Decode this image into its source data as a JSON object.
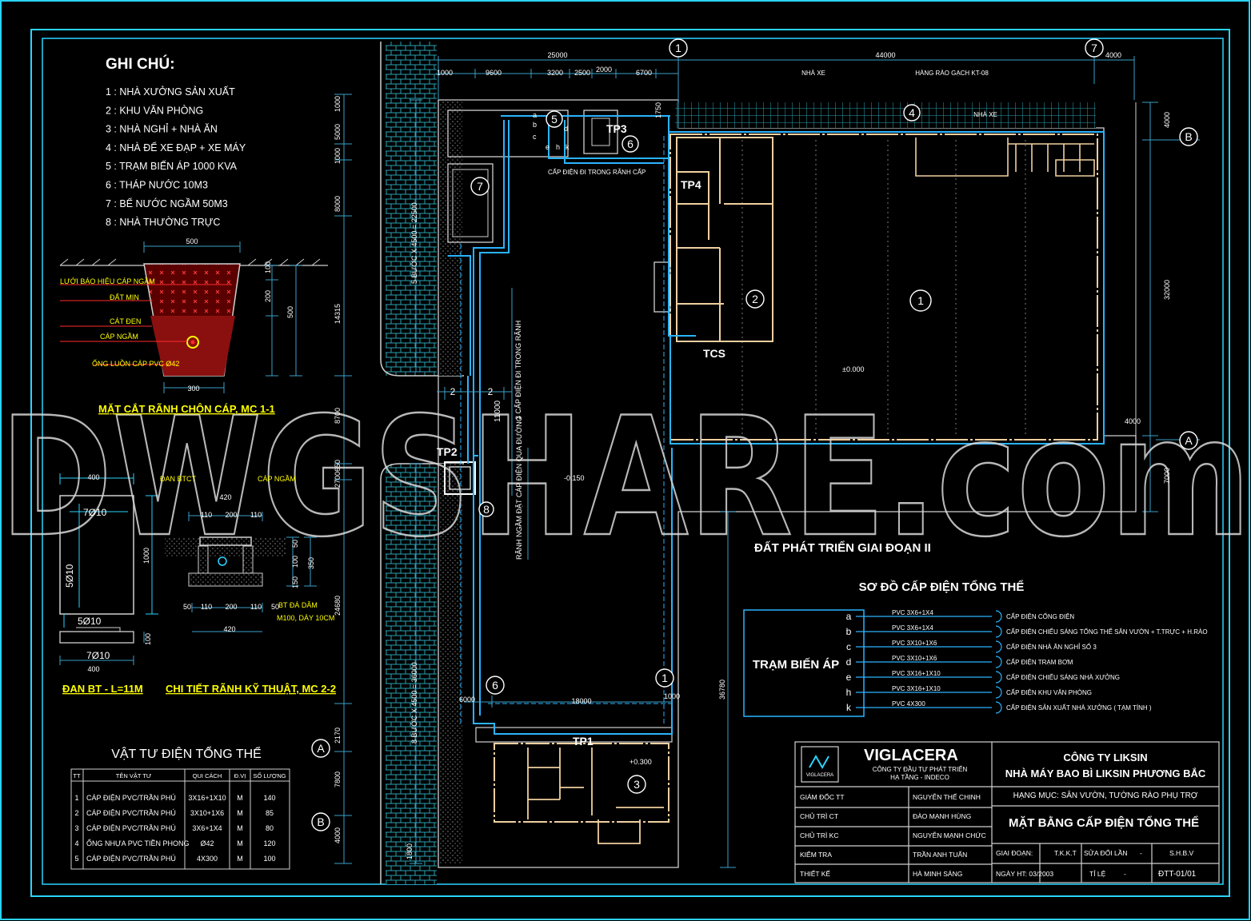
{
  "colors": {
    "background": "#000000",
    "frame": "#2ad4ff",
    "white": "#ffffff",
    "yellow": "#ffff00",
    "cable": "#2ab4ff",
    "dim": "#3aa0c8",
    "wall": "#f0d0a0",
    "red": "#e8242a",
    "watermark": "#d8d8d8"
  },
  "notes": {
    "title": "GHI CHÚ:",
    "items": [
      "1 : NHÀ XƯỞNG SẢN XUẤT",
      "2 : KHU VĂN PHÒNG",
      "3 : NHÀ NGHỈ + NHÀ ĂN",
      "4 : NHÀ ĐỂ XE ĐẠP + XE MÁY",
      "5 : TRẠM BIẾN ÁP 1000 KVA",
      "6 : THÁP NƯỚC 10M3",
      "7 : BỂ NƯỚC NGẦM 50M3",
      "8 : NHÀ THƯỜNG TRỰC"
    ]
  },
  "trench_section": {
    "title": "MẶT CẮT RÃNH CHÔN CÁP, MC 1-1",
    "labels": [
      "LƯỚI BÁO HIỆU CÁP NGẦM",
      "ĐẤT MỊN",
      "CÁT ĐEN",
      "CÁP NGẦM",
      "ỐNG LUỒN CÁP PVC Ø42"
    ],
    "dims": [
      "500",
      "100",
      "200",
      "500",
      "300"
    ]
  },
  "slab_detail": {
    "title": "ĐAN BT - L=11M",
    "dims": [
      "400",
      "1000",
      "100",
      "400"
    ],
    "rebar": [
      "7Ø10",
      "5Ø10",
      "5Ø10",
      "7Ø10"
    ]
  },
  "channel_detail": {
    "title": "CHI TIẾT RÃNH KỸ THUẬT, MC 2-2",
    "labels": [
      "ĐAN BTCT",
      "CÁP NGẦM",
      "BT ĐÁ DĂM",
      "M100, DÀY 10CM"
    ],
    "top_dims": [
      "420",
      "110",
      "200",
      "110"
    ],
    "bottom_dims": [
      "50",
      "110",
      "200",
      "110",
      "50"
    ],
    "total": "420",
    "side_dims": [
      "50",
      "100",
      "150",
      "100",
      "350"
    ]
  },
  "materials": {
    "title": "VẬT TƯ ĐIỆN TỔNG THỂ",
    "headers": [
      "TT",
      "TÊN VẬT TƯ",
      "QUI CÁCH",
      "Đ.VỊ",
      "SỐ LƯỢNG"
    ],
    "rows": [
      [
        "1",
        "CÁP ĐIỆN  PVC/TRẦN PHÚ",
        "3X16+1X10",
        "M",
        "140"
      ],
      [
        "2",
        "CÁP ĐIỆN  PVC/TRẦN PHÚ",
        "3X10+1X6",
        "M",
        "85"
      ],
      [
        "3",
        "CÁP ĐIỆN  PVC/TRẦN PHÚ",
        "3X6+1X4",
        "M",
        "80"
      ],
      [
        "4",
        "ỐNG NHỰA PVC TIỀN PHONG",
        "Ø42",
        "M",
        "120"
      ],
      [
        "5",
        "CÁP ĐIỆN  PVC/TRẦN PHÚ",
        "4X300",
        "M",
        "100"
      ]
    ]
  },
  "site": {
    "top_dims": [
      "25000",
      "44000",
      "4000",
      "1000",
      "9600",
      "3200",
      "2500",
      "2000",
      "6700",
      "1750"
    ],
    "left_dims": [
      "1000",
      "5000",
      "1000",
      "8000",
      "14315",
      "8700",
      "2700",
      "650",
      "24680",
      "2170",
      "7800",
      "4000",
      "1800"
    ],
    "right_dims": [
      "4000",
      "32000",
      "4000",
      "7000"
    ],
    "vertical_notes": [
      "5 BƯỚC X 4500 = 22500",
      "8 BƯỚC X 4500 = 36000",
      "3 CẤP ĐIỆN ĐI TRONG RÃNH",
      "RÃNH NGẦM ĐẶT CÁP ĐIỆN QUA ĐƯỜNG",
      "11000",
      "36780"
    ],
    "grid": [
      "1",
      "7",
      "B",
      "A",
      "6",
      "1",
      "A",
      "B"
    ],
    "labels": {
      "nha_xe_1": "NHÀ XE",
      "nha_xe_2": "NHÀ XE",
      "fence": "HÀNG RÀO GẠCH KT-08",
      "cable_trench": "CẤP ĐIỆN ĐI TRONG RÃNH CẤP",
      "level_0": "±0.000",
      "level_n015": "-0.150",
      "level_p03": "+0.300",
      "phase2": "ĐẤT PHÁT TRIỂN GIAI ĐOẠN II",
      "dim_18000": "18000",
      "dim_6000": "6000",
      "dim_1000": "1000",
      "n2a": "2",
      "n2b": "2"
    },
    "buildings": [
      "1",
      "2",
      "3",
      "4",
      "5",
      "6",
      "7",
      "8"
    ],
    "panels": [
      "TP1",
      "TP2",
      "TP3",
      "TP4",
      "TCS"
    ],
    "feeder_letters": [
      "a",
      "b",
      "c",
      "d",
      "e",
      "h",
      "k"
    ]
  },
  "power_diagram": {
    "title": "SƠ ĐỒ CẤP ĐIỆN TỔNG THỂ",
    "source": "TRẠM BIẾN ÁP",
    "lines": [
      {
        "id": "a",
        "cable": "PVC  3X6+1X4",
        "target": "CẤP ĐIỆN CỔNG ĐIỆN"
      },
      {
        "id": "b",
        "cable": "PVC  3X6+1X4",
        "target": "CẤP ĐIỆN CHIẾU SÁNG TỔNG THỂ SÂN VƯỜN + T.TRỰC + H.RÀO"
      },
      {
        "id": "c",
        "cable": "PVC  3X10+1X6",
        "target": "CẤP ĐIỆN NHÀ ĂN NGHỈ SỐ 3"
      },
      {
        "id": "d",
        "cable": "PVC  3X10+1X6",
        "target": "CẤP ĐIỆN TRẠM BƠM"
      },
      {
        "id": "e",
        "cable": "PVC  3X16+1X10",
        "target": "CẤP ĐIỆN CHIẾU SÁNG NHÀ XƯỞNG"
      },
      {
        "id": "h",
        "cable": "PVC  3X16+1X10",
        "target": "CẤP ĐIỆN KHU VĂN PHÒNG"
      },
      {
        "id": "k",
        "cable": "PVC  4X300",
        "target": "CẤP ĐIỆN SẢN XUẤT NHÀ XƯỞNG ( TẠM TÍNH )"
      }
    ]
  },
  "title_block": {
    "brand": "VIGLACERA",
    "logo_text": "VIGLACERA",
    "subsidiary": "CÔNG TY ĐẦU TƯ PHÁT TRIỂN",
    "subsidiary2": "HẠ TẦNG - INDECO",
    "client": "CÔNG TY LIKSIN",
    "project": "NHÀ MÁY BAO BÌ LIKSIN PHƯƠNG BẮC",
    "category": "HẠNG MỤC: SÂN VƯỜN, TƯỜNG RÀO PHỤ TRỢ",
    "drawing_title": "MẶT BẰNG CẤP ĐIỆN TỔNG THỂ",
    "roles": [
      {
        "role": "GIÁM ĐỐC TT",
        "name": "NGUYỄN THẾ CHINH"
      },
      {
        "role": "CHỦ TRÌ CT",
        "name": "ĐÀO MẠNH HÙNG"
      },
      {
        "role": "CHỦ TRÌ KC",
        "name": "NGUYỄN MẠNH CHỨC"
      },
      {
        "role": "KIỂM TRA",
        "name": "TRẦN ANH TUẤN"
      },
      {
        "role": "THIẾT KẾ",
        "name": "HÀ MINH SÁNG"
      }
    ],
    "stage_label": "GIAI ĐOẠN:",
    "stage": "T.K.K.T",
    "revision_label": "SỬA ĐỔI LẦN",
    "revision": "-",
    "code": "S.H.B.V",
    "date_label": "NGÀY HT: 03/2003",
    "scale_label": "TỈ LỆ",
    "scale": "-",
    "sheet": "ĐTT-01/01"
  },
  "watermark": "DWGSHARE.com"
}
